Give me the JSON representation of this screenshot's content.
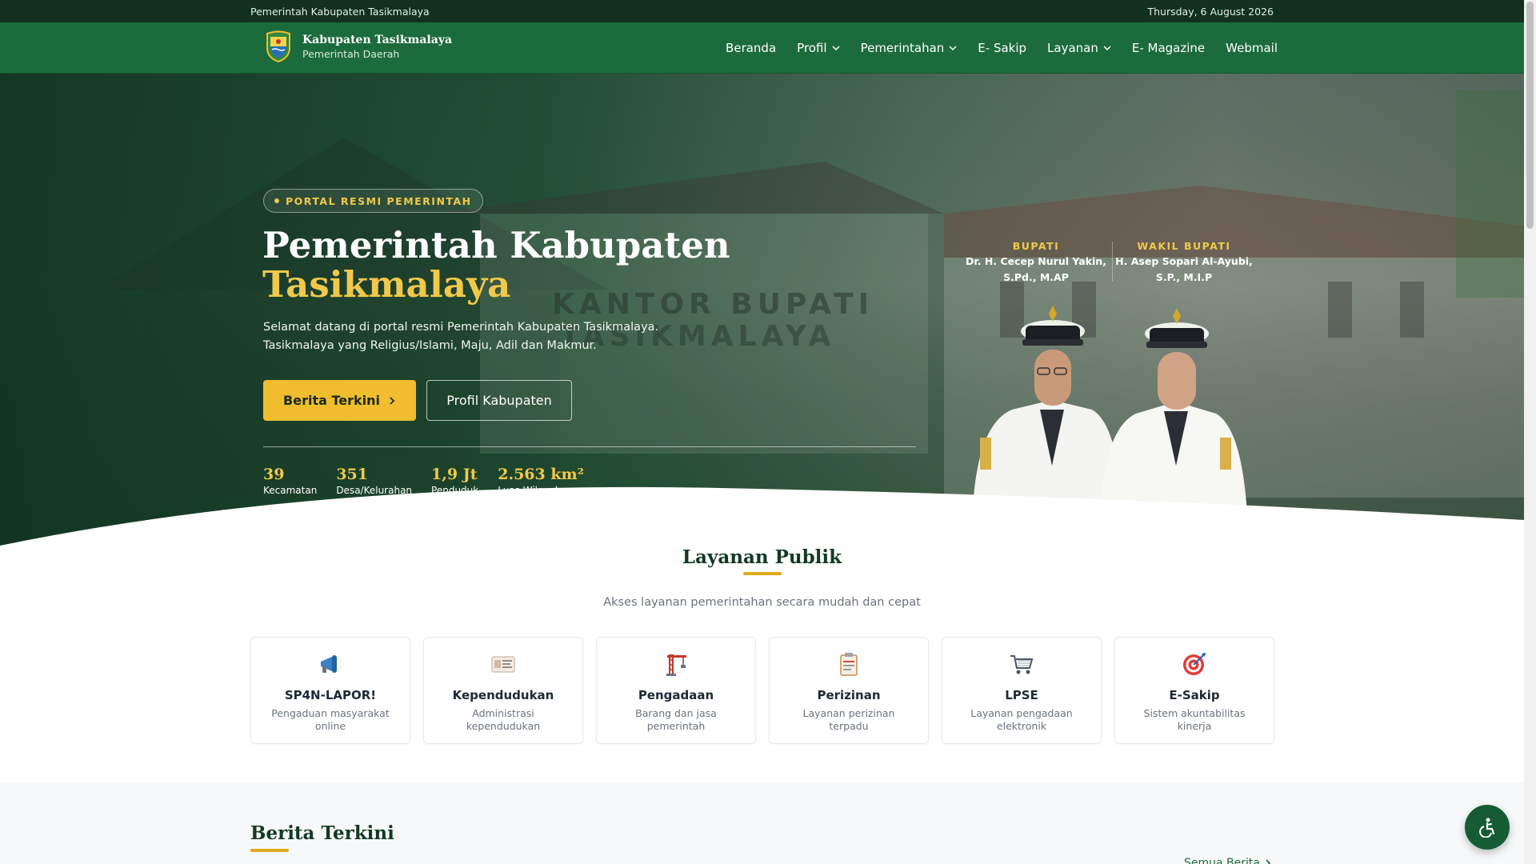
{
  "topbar": {
    "left_text": "Pemerintah Kabupaten Tasikmalaya",
    "date": "Thursday, 6 August 2026"
  },
  "header": {
    "brand_name": "Kabupaten Tasikmalaya",
    "brand_sub": "Pemerintah Daerah",
    "logo_icon": "regency-crest-icon",
    "nav": [
      {
        "label": "Beranda",
        "dropdown": false
      },
      {
        "label": "Profil",
        "dropdown": true
      },
      {
        "label": "Pemerintahan",
        "dropdown": true
      },
      {
        "label": "E- Sakip",
        "dropdown": false
      },
      {
        "label": "Layanan",
        "dropdown": true
      },
      {
        "label": "E- Magazine",
        "dropdown": false
      },
      {
        "label": "Webmail",
        "dropdown": false
      }
    ]
  },
  "hero": {
    "badge": "PORTAL RESMI PEMERINTAH",
    "title_line1": "Pemerintah Kabupaten",
    "title_line2": "Tasikmalaya",
    "description_line1": "Selamat datang di portal resmi Pemerintah Kabupaten Tasikmalaya.",
    "description_line2": "Tasikmalaya yang Religius/Islami, Maju, Adil dan Makmur.",
    "btn_primary": "Berita Terkini",
    "btn_secondary": "Profil Kabupaten",
    "stats": [
      {
        "value": "39",
        "label": "Kecamatan"
      },
      {
        "value": "351",
        "label": "Desa/Kelurahan"
      },
      {
        "value": "1,9 Jt",
        "label": "Penduduk"
      },
      {
        "value": "2.563 km²",
        "label": "Luas Wilayah"
      }
    ],
    "officials": [
      {
        "role": "BUPATI",
        "name_line1": "Dr. H. Cecep Nurul Yakin,",
        "name_line2": "S.Pd., M.AP"
      },
      {
        "role": "WAKIL BUPATI",
        "name_line1": "H. Asep Sopari Al-Ayubi,",
        "name_line2": "S.P., M.I.P"
      }
    ],
    "background_text": "KANTOR BUPATI TASIKMALAYA"
  },
  "services": {
    "title": "Layanan Publik",
    "subtitle": "Akses layanan pemerintahan secara mudah dan cepat",
    "items": [
      {
        "icon": "megaphone-icon",
        "title": "SP4N-LAPOR!",
        "desc": "Pengaduan masyarakat online"
      },
      {
        "icon": "id-card-icon",
        "title": "Kependudukan",
        "desc": "Administrasi kependudukan"
      },
      {
        "icon": "construction-crane-icon",
        "title": "Pengadaan",
        "desc": "Barang dan jasa pemerintah"
      },
      {
        "icon": "clipboard-icon",
        "title": "Perizinan",
        "desc": "Layanan perizinan terpadu"
      },
      {
        "icon": "shopping-cart-icon",
        "title": "LPSE",
        "desc": "Layanan pengadaan elektronik"
      },
      {
        "icon": "target-icon",
        "title": "E-Sakip",
        "desc": "Sistem akuntabilitas kinerja"
      }
    ]
  },
  "news": {
    "title": "Berita Terkini",
    "see_all": "Semua Berita"
  },
  "accessibility_icon": "accessibility-icon",
  "colors": {
    "primary_green": "#1c6b3c",
    "dark_green": "#11301f",
    "accent_gold": "#f0bd2e"
  }
}
